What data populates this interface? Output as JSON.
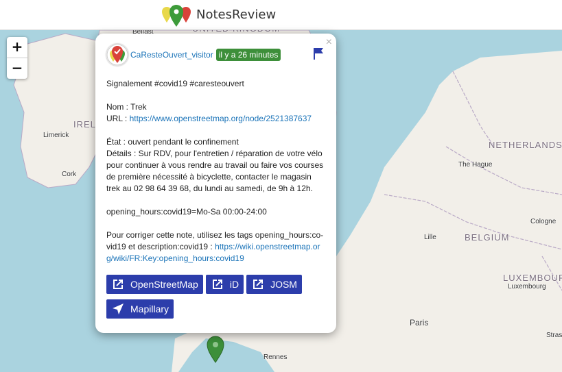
{
  "app": {
    "title": "NotesReview"
  },
  "zoom": {
    "in_label": "+",
    "out_label": "−"
  },
  "map": {
    "countries": [
      "UNITED KINGDOM",
      "IRELAND",
      "NETHERLANDS",
      "BELGIUM",
      "LUXEMBOURG"
    ],
    "cities": [
      "Belfast",
      "Limerick",
      "Cork",
      "The Hague",
      "Lille",
      "Cologne",
      "Luxembourg",
      "Paris",
      "Rennes",
      "Stras"
    ]
  },
  "popup": {
    "close_label": "×",
    "author": "CaResteOuvert_visitor",
    "age": "il y a 26 minutes",
    "lines": {
      "l1": "Signalement #covid19 #caresteouvert",
      "l2": "Nom : Trek",
      "l3_prefix": "URL : ",
      "l3_link": "https://www.openstreetmap.org/node/2521387637",
      "l4": "État : ouvert pendant le confinement",
      "l5": "Détails : Sur RDV, pour l'entretien / réparation de votre vélo pour continuer à vous rendre au travail ou faire vos courses de première nécessité à bicyclette, contacter le magasin trek au 02 98 64 39 68, du lundi au samedi, de 9h à 12h.",
      "l6": "opening_hours:covid19=Mo-Sa 00:00-24:00",
      "l7_prefix": "Pour corriger cette note, utilisez les tags opening_hours:co-vid19 et description:covid19 : ",
      "l7_link": "https://wiki.openstreetmap.org/wiki/FR:Key:opening_hours:covid19"
    },
    "buttons": {
      "osm": "OpenStreetMap",
      "id": "iD",
      "josm": "JOSM",
      "mapillary": "Mapillary"
    }
  },
  "colors": {
    "accent": "#2c3dab",
    "age_badge": "#3d8f3a",
    "link": "#1a73b8",
    "marker": "#3d8f3a"
  }
}
